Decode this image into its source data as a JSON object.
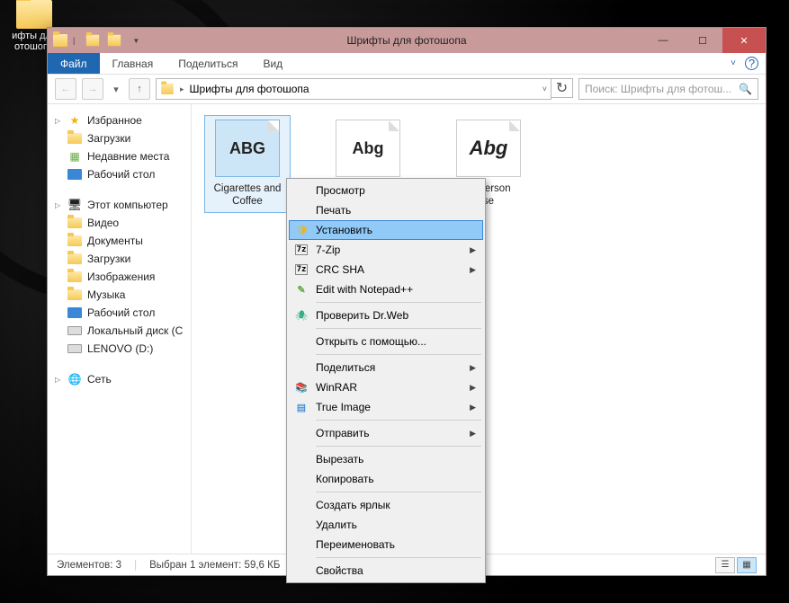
{
  "desktop": {
    "folder_label": "ифты для\nотошопа"
  },
  "titlebar": {
    "title": "Шрифты для фотошопа"
  },
  "ribbon": {
    "file": "Файл",
    "tabs": [
      "Главная",
      "Поделиться",
      "Вид"
    ]
  },
  "address": {
    "location": "Шрифты для фотошопа",
    "search_placeholder": "Поиск: Шрифты для фотош..."
  },
  "nav": {
    "favorites": {
      "label": "Избранное",
      "items": [
        "Загрузки",
        "Недавние места",
        "Рабочий стол"
      ]
    },
    "computer": {
      "label": "Этот компьютер",
      "items": [
        "Видео",
        "Документы",
        "Загрузки",
        "Изображения",
        "Музыка",
        "Рабочий стол",
        "Локальный диск (C",
        "LENOVO (D:)"
      ]
    },
    "network": {
      "label": "Сеть"
    }
  },
  "files": [
    {
      "preview": "ABG",
      "name": "Cigarettes and Coffee"
    },
    {
      "preview": "Abg",
      "name": ""
    },
    {
      "preview": "Abg",
      "name": "2_Person\nse"
    }
  ],
  "status": {
    "count": "Элементов: 3",
    "selection": "Выбран 1 элемент: 59,6 КБ"
  },
  "ctx": {
    "items": [
      {
        "label": "Просмотр"
      },
      {
        "label": "Печать"
      },
      {
        "label": "Установить",
        "hover": true,
        "icon": "shield"
      },
      {
        "label": "7-Zip",
        "icon": "7z",
        "sub": true
      },
      {
        "label": "CRC SHA",
        "icon": "7z",
        "sub": true
      },
      {
        "label": "Edit with Notepad++",
        "icon": "npp"
      },
      {
        "sep": true
      },
      {
        "label": "Проверить Dr.Web",
        "icon": "drweb"
      },
      {
        "sep": true
      },
      {
        "label": "Открыть с помощью..."
      },
      {
        "sep": true
      },
      {
        "label": "Поделиться",
        "sub": true
      },
      {
        "label": "WinRAR",
        "icon": "winrar",
        "sub": true
      },
      {
        "label": "True Image",
        "icon": "ti",
        "sub": true
      },
      {
        "sep": true
      },
      {
        "label": "Отправить",
        "sub": true
      },
      {
        "sep": true
      },
      {
        "label": "Вырезать"
      },
      {
        "label": "Копировать"
      },
      {
        "sep": true
      },
      {
        "label": "Создать ярлык"
      },
      {
        "label": "Удалить"
      },
      {
        "label": "Переименовать"
      },
      {
        "sep": true
      },
      {
        "label": "Свойства"
      }
    ]
  }
}
